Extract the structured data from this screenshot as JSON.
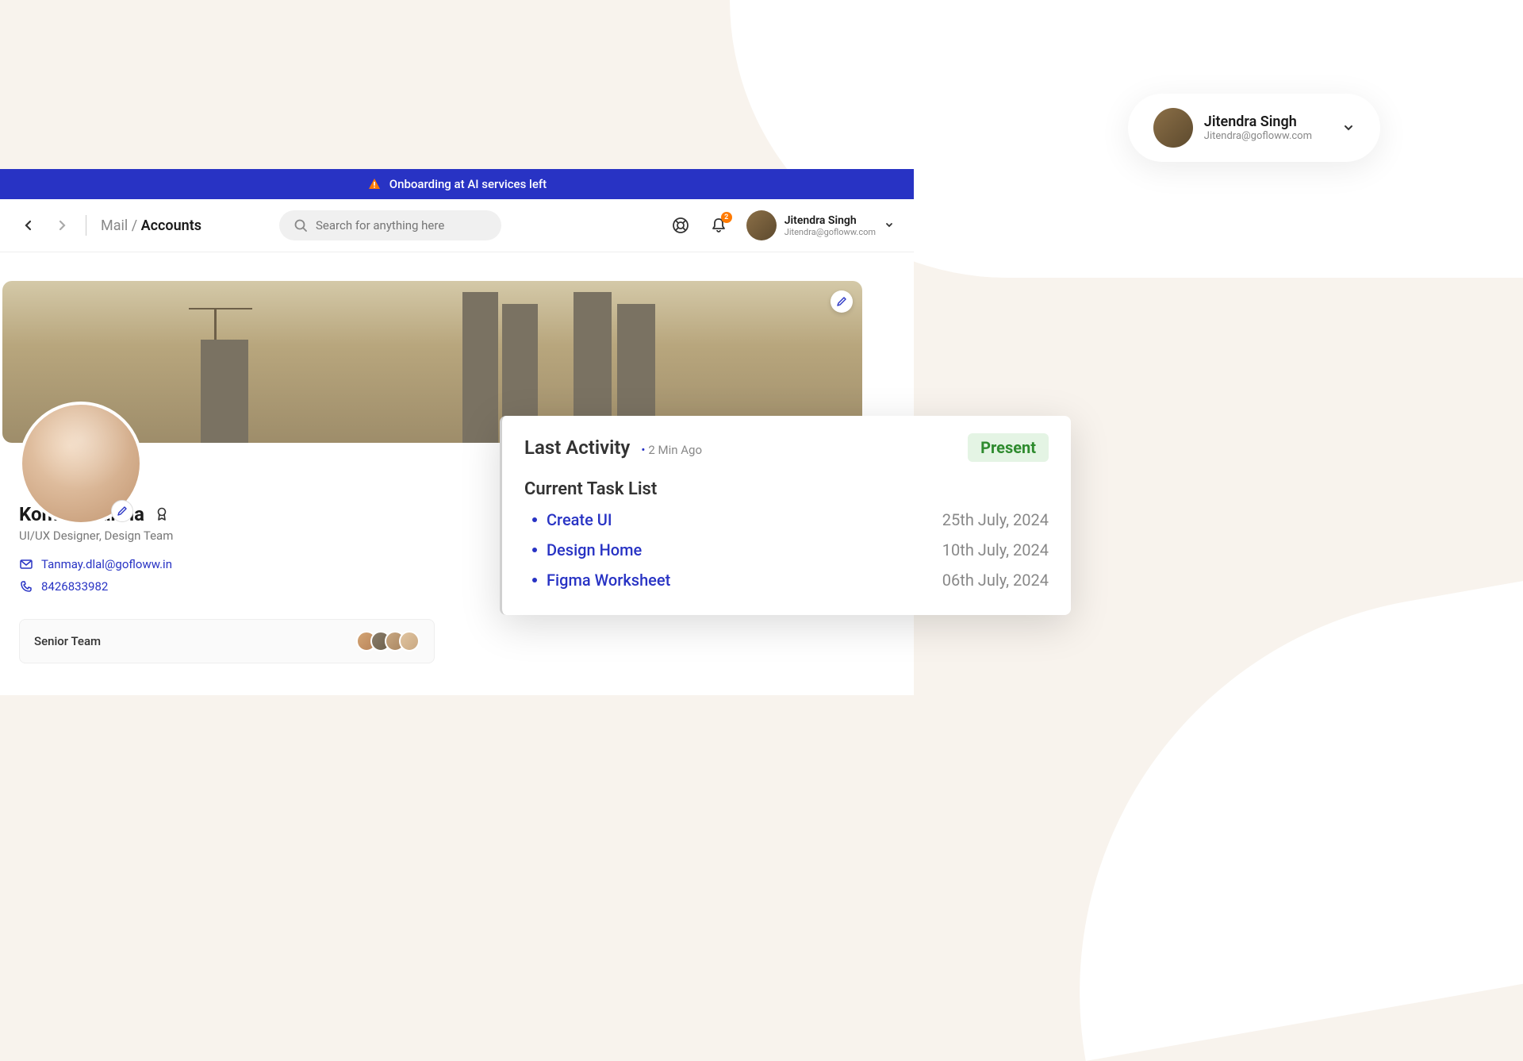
{
  "float_user": {
    "name": "Jitendra Singh",
    "email": "Jitendra@gofloww.com"
  },
  "notice": {
    "text": "Onboarding at AI services left"
  },
  "breadcrumb": {
    "prefix": "Mail / ",
    "current": "Accounts"
  },
  "search": {
    "placeholder": "Search for anything here"
  },
  "top_user": {
    "name": "Jitendra Singh",
    "email": "Jitendra@gofloww.com"
  },
  "notification_count": "2",
  "profile": {
    "name": "Komal Sharma",
    "title": "UI/UX Designer, Design Team",
    "email": "Tanmay.dlal@gofloww.in",
    "phone": "8426833982"
  },
  "team": {
    "title": "Senior Team"
  },
  "activity": {
    "title": "Last Activity",
    "time": "2 Min Ago",
    "status": "Present",
    "tasklist_title": "Current Task List",
    "tasks": [
      {
        "name": "Create UI",
        "date": "25th July, 2024"
      },
      {
        "name": "Design Home",
        "date": "10th July, 2024"
      },
      {
        "name": "Figma Worksheet",
        "date": "06th July, 2024"
      }
    ]
  }
}
